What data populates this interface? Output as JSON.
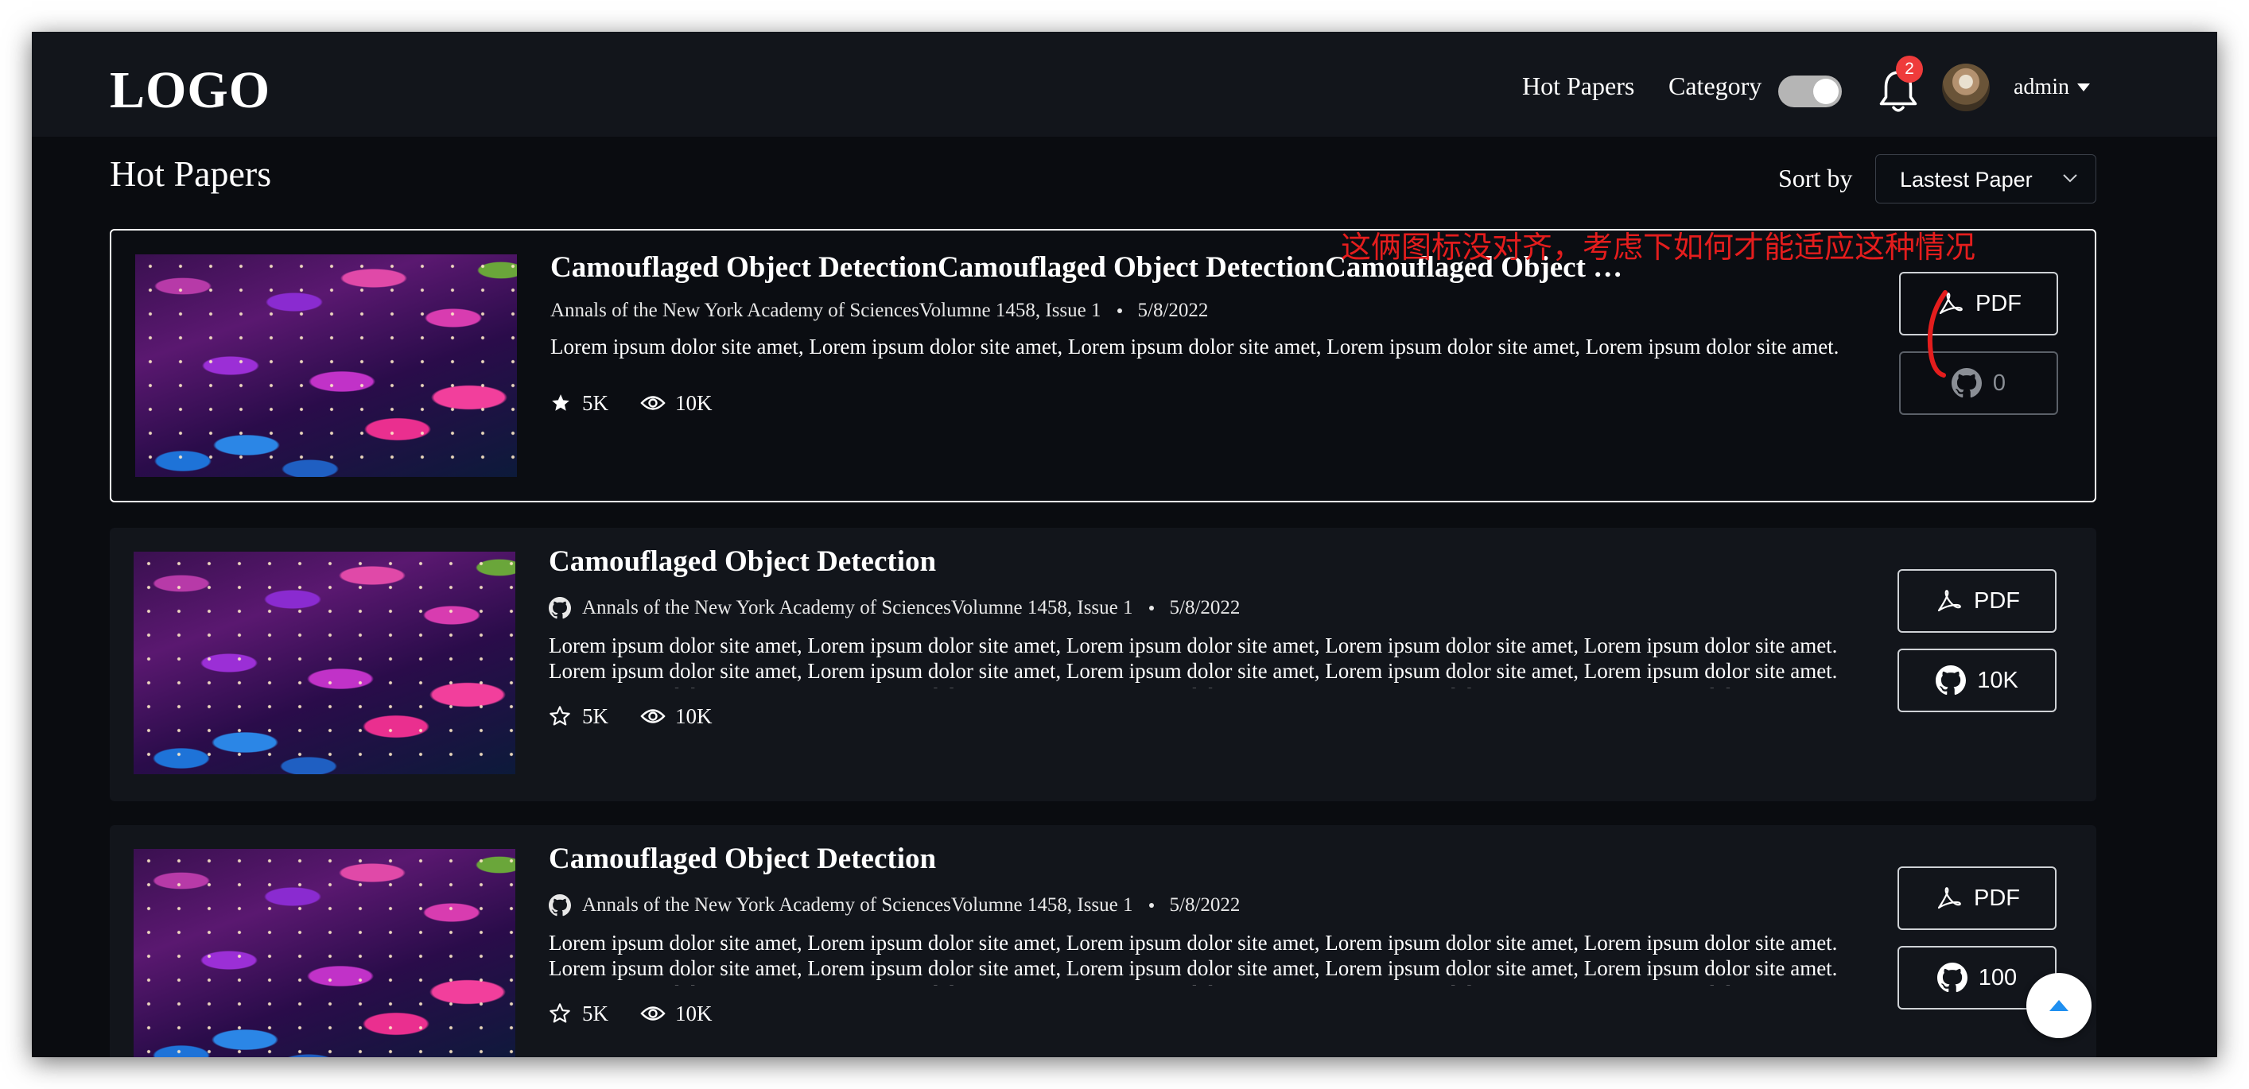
{
  "header": {
    "logo": "LOGO",
    "nav": [
      "Hot Papers",
      "Category"
    ],
    "theme_toggle_on": true,
    "notifications_count": "2",
    "user": "admin"
  },
  "page": {
    "title": "Hot Papers",
    "sort_label": "Sort by",
    "sort_value": "Lastest Paper"
  },
  "papers": [
    {
      "title": "Camouflaged Object DetectionCamouflaged Object DetectionCamouflaged Object Detection",
      "journal": "Annals of the New York Academy of SciencesVolumne 1458, Issue 1",
      "date": "5/8/2022",
      "abstract": "Lorem ipsum dolor site amet, Lorem ipsum dolor site amet, Lorem ipsum dolor site amet, Lorem ipsum dolor site amet, Lorem ipsum dolor site amet.",
      "stars": "5K",
      "views": "10K",
      "pdf_label": "PDF",
      "github_count": "0",
      "starred": true
    },
    {
      "title": "Camouflaged Object Detection",
      "journal": "Annals of the New York Academy of SciencesVolumne 1458, Issue 1",
      "date": "5/8/2022",
      "abstract": "Lorem ipsum dolor site amet, Lorem ipsum dolor site amet, Lorem ipsum dolor site amet, Lorem ipsum dolor site amet, Lorem ipsum dolor site amet. Lorem ipsum dolor site amet, Lorem ipsum dolor site amet, Lorem ipsum dolor site amet, Lorem ipsum dolor site amet, Lorem ipsum dolor site amet. Lorem ipsum dolor site amet, Lorem ipsum dolor site amet, Lorem ipsum dolor site amet, Lorem ipsum dolor site amet, Lorem ipsum dolor site amet.",
      "stars": "5K",
      "views": "10K",
      "pdf_label": "PDF",
      "github_count": "10K",
      "starred": false
    },
    {
      "title": "Camouflaged Object Detection",
      "journal": "Annals of the New York Academy of SciencesVolumne 1458, Issue 1",
      "date": "5/8/2022",
      "abstract": "Lorem ipsum dolor site amet, Lorem ipsum dolor site amet, Lorem ipsum dolor site amet, Lorem ipsum dolor site amet, Lorem ipsum dolor site amet. Lorem ipsum dolor site amet, Lorem ipsum dolor site amet, Lorem ipsum dolor site amet, Lorem ipsum dolor site amet, Lorem ipsum dolor site amet. Lorem ipsum dolor site amet, Lorem ipsum dolor site amet, Lorem ipsum dolor site amet, Lorem ipsum dolor site amet, Lorem ipsum dolor site amet.",
      "stars": "5K",
      "views": "10K",
      "pdf_label": "PDF",
      "github_count": "100",
      "starred": false
    }
  ],
  "annotation": "这俩图标没对齐，考虑下如何才能适应这种情况",
  "colors": {
    "background": "#0a0c10",
    "card": "#12151b",
    "annotation_red": "#e41d1d",
    "badge_red": "#ef3b3b",
    "scroll_top_blue": "#1f8ff0"
  }
}
